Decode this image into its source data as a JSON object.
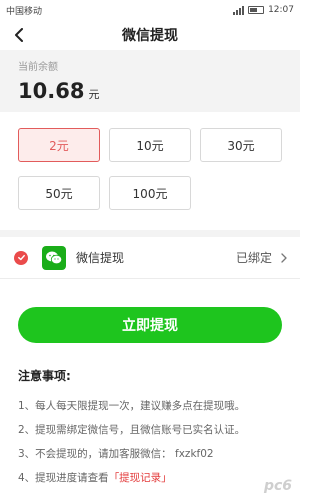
{
  "status_bar": {
    "carrier": "中国移动",
    "time": "12:07"
  },
  "header": {
    "back_icon": "arrow-left-icon",
    "title": "微信提现"
  },
  "balance": {
    "label": "当前余额",
    "amount": "10.68",
    "unit": "元"
  },
  "amounts": [
    {
      "label": "2元",
      "selected": true
    },
    {
      "label": "10元",
      "selected": false
    },
    {
      "label": "30元",
      "selected": false
    },
    {
      "label": "50元",
      "selected": false
    },
    {
      "label": "100元",
      "selected": false
    }
  ],
  "method": {
    "check_icon": "check-circle-icon",
    "icon": "wechat-icon",
    "label": "微信提现",
    "status": "已绑定",
    "chevron": "chevron-right-icon"
  },
  "submit": {
    "label": "立即提现"
  },
  "notes": {
    "title": "注意事项:",
    "items": [
      "1、每人每天限提现一次，建议赚多点在提现哦。",
      "2、提现需绑定微信号，且微信账号已实名认证。",
      "3、不会提现的，请加客服微信： fxzkf02",
      "4、提现进度请查看"
    ],
    "link": "「提现记录」"
  },
  "watermark": "pc6",
  "colors": {
    "accent_green": "#1ec51e",
    "selected_red": "#e25b5b",
    "wechat_green": "#1aad19"
  }
}
